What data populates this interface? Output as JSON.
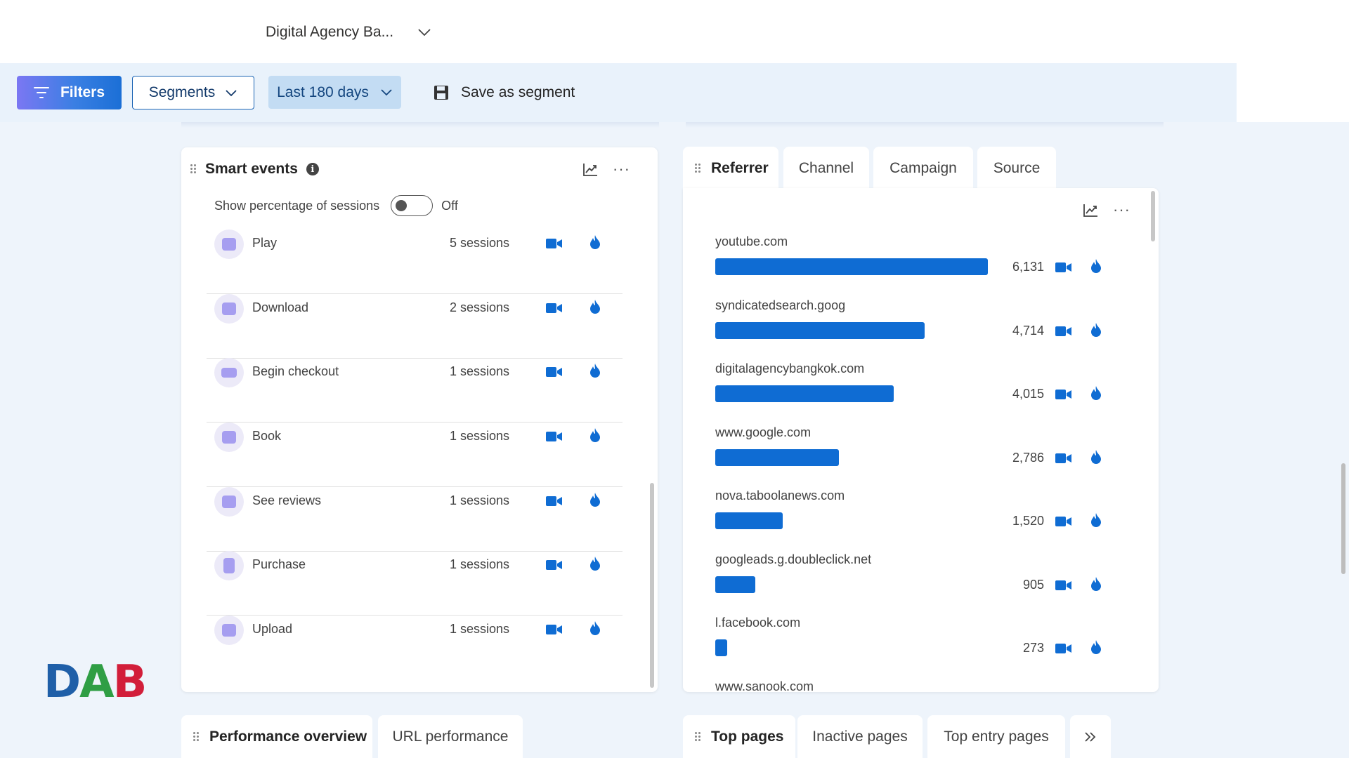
{
  "header": {
    "project_name": "Digital Agency Ba..."
  },
  "toolbar": {
    "filters_label": "Filters",
    "segments_label": "Segments",
    "date_range_label": "Last 180 days",
    "save_segment_label": "Save as segment"
  },
  "smart_events": {
    "title": "Smart events",
    "toggle_label": "Show percentage of sessions",
    "toggle_state": "Off",
    "events": [
      {
        "name": "Play",
        "count": "5 sessions"
      },
      {
        "name": "Download",
        "count": "2 sessions"
      },
      {
        "name": "Begin checkout",
        "count": "1 sessions"
      },
      {
        "name": "Book",
        "count": "1 sessions"
      },
      {
        "name": "See reviews",
        "count": "1 sessions"
      },
      {
        "name": "Purchase",
        "count": "1 sessions"
      },
      {
        "name": "Upload",
        "count": "1 sessions"
      }
    ]
  },
  "referrer_panel": {
    "tabs": [
      "Referrer",
      "Channel",
      "Campaign",
      "Source"
    ],
    "active_tab": "Referrer",
    "items": [
      {
        "label": "youtube.com",
        "value": "6,131",
        "share": 1.0
      },
      {
        "label": "syndicatedsearch.goog",
        "value": "4,714",
        "share": 0.769
      },
      {
        "label": "digitalagencybangkok.com",
        "value": "4,015",
        "share": 0.655
      },
      {
        "label": "www.google.com",
        "value": "2,786",
        "share": 0.454
      },
      {
        "label": "nova.taboolanews.com",
        "value": "1,520",
        "share": 0.248
      },
      {
        "label": "googleads.g.doubleclick.net",
        "value": "905",
        "share": 0.148
      },
      {
        "label": "l.facebook.com",
        "value": "273",
        "share": 0.045
      },
      {
        "label": "www.sanook.com",
        "value": "",
        "share": 0
      }
    ]
  },
  "bottom_left_tabs": [
    "Performance overview",
    "URL performance"
  ],
  "bottom_right_tabs": [
    "Top pages",
    "Inactive pages",
    "Top entry pages"
  ],
  "logo": {
    "text": "DAB",
    "colors": [
      "#1f5fa8",
      "#2f9e44",
      "#d21e3a"
    ]
  },
  "colors": {
    "accent": "#0f6cd3",
    "event_icon": "#a69ef0"
  },
  "icons": {
    "filter": "filter-icon",
    "chevron": "chevron-down-icon",
    "save": "floppy-disk-icon",
    "insights": "chart-trend-icon",
    "more": "more-horizontal-icon",
    "recording": "video-camera-icon",
    "heatmap": "flame-icon",
    "overflow": "double-chevron-right-icon"
  }
}
